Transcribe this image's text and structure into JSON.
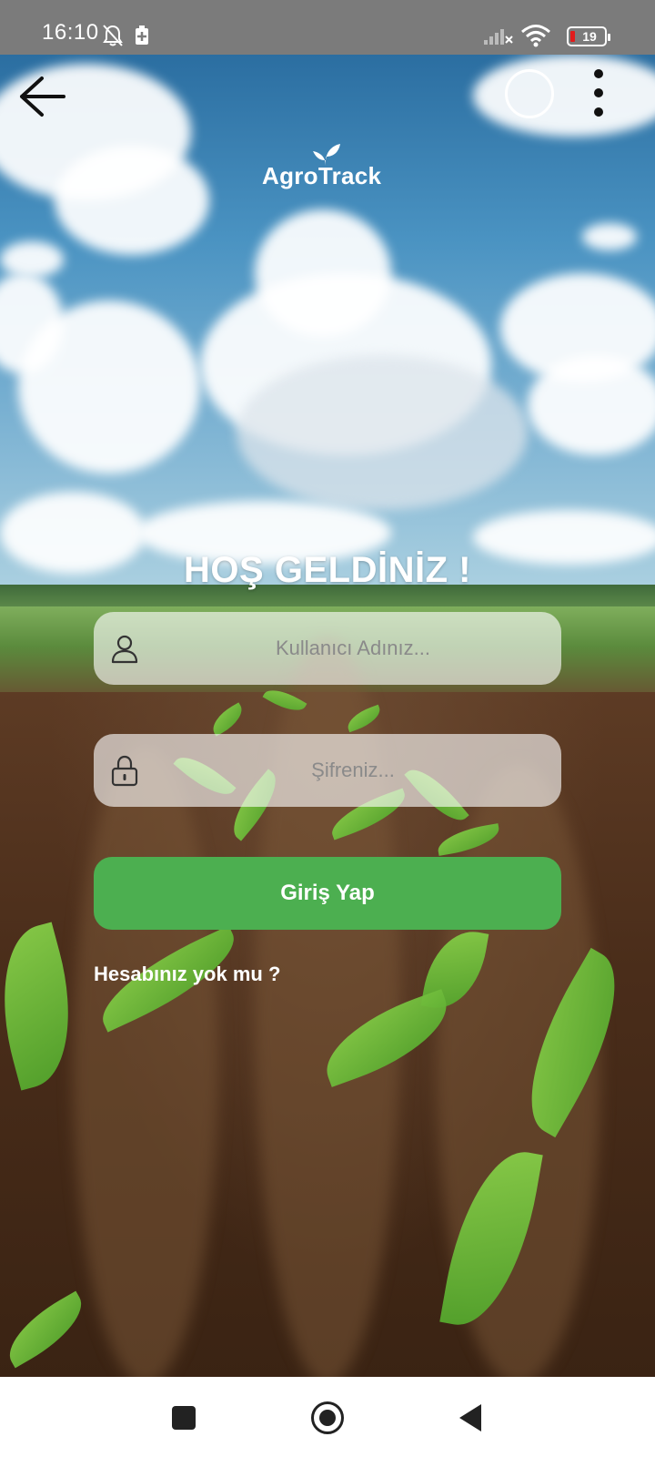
{
  "status_bar": {
    "time": "16:10",
    "battery_level": "19",
    "icons": [
      "bell-off-icon",
      "battery-saver-icon",
      "signal-icon",
      "wifi-icon",
      "battery-icon"
    ]
  },
  "nav": {
    "back_icon": "arrow-left-icon",
    "circle_icon": "circle-icon",
    "more_icon": "more-vertical-icon"
  },
  "logo": {
    "text": "AgroTrack",
    "icon": "sprout-icon"
  },
  "welcome_title": "HOŞ GELDİNİZ !",
  "form": {
    "username": {
      "placeholder": "Kullanıcı Adınız...",
      "value": "",
      "icon": "user-icon"
    },
    "password": {
      "placeholder": "Şifreniz...",
      "value": "",
      "icon": "lock-icon"
    },
    "login_label": "Giriş Yap",
    "signup_label": "Hesabınız yok mu ?"
  },
  "colors": {
    "primary_button": "#4caf50",
    "battery_low": "#e11b1b"
  },
  "system_nav": {
    "icons": [
      "recent-apps-icon",
      "home-icon",
      "back-icon"
    ]
  }
}
